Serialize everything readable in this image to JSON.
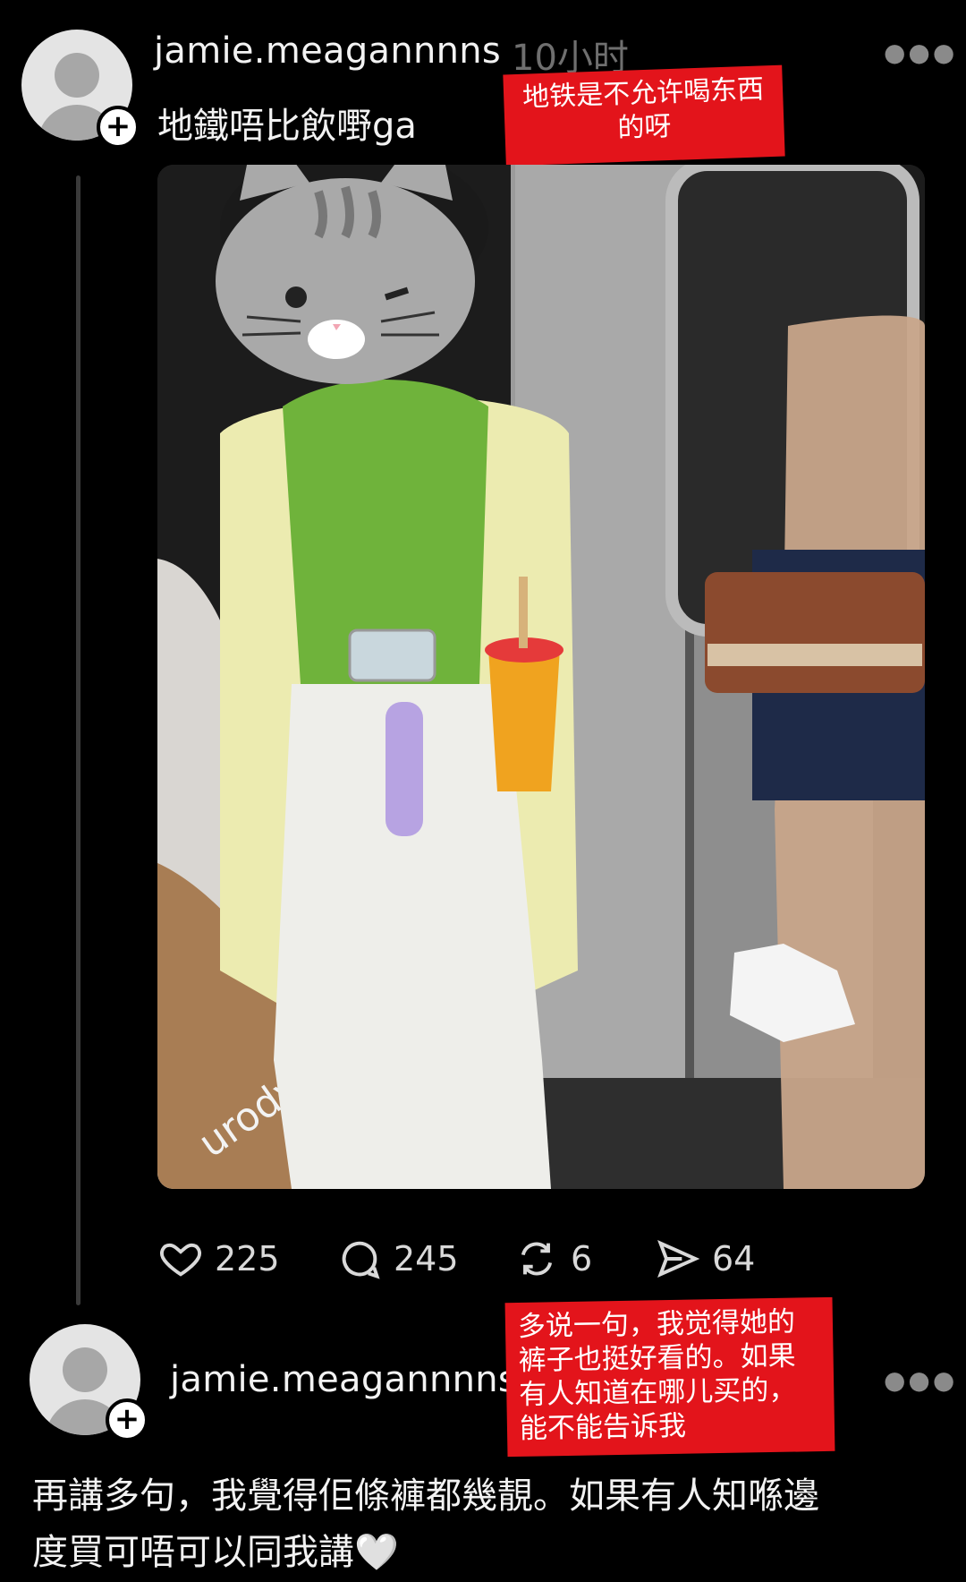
{
  "post": {
    "username": "jamie.meagannnns",
    "time": "10小时",
    "text": "地鐵唔比￼飲嘢ga",
    "overlay_note": "地铁是不允许喝东西的呀",
    "actions": {
      "likes": "225",
      "comments": "245",
      "reposts": "6",
      "shares": "64"
    },
    "photo_text": "urody"
  },
  "reply": {
    "username": "jamie.meagannnns",
    "overlay_note": "多说一句，我觉得她的裤子也挺好看的。如果有人知道在哪儿买的，能不能告诉我",
    "text_line1": "再講多句，我覺得佢條褲都幾靚。如果有人知喺邊",
    "text_line2": "度買可唔可以同我講🤍"
  },
  "icons": [
    "avatar",
    "plus-icon",
    "more-icon",
    "heart-icon",
    "comment-icon",
    "repost-icon",
    "send-icon",
    "cat-face-icon"
  ],
  "colors": {
    "background": "#000000",
    "overlay_red": "#e3141b",
    "muted": "#6f6f6f"
  }
}
